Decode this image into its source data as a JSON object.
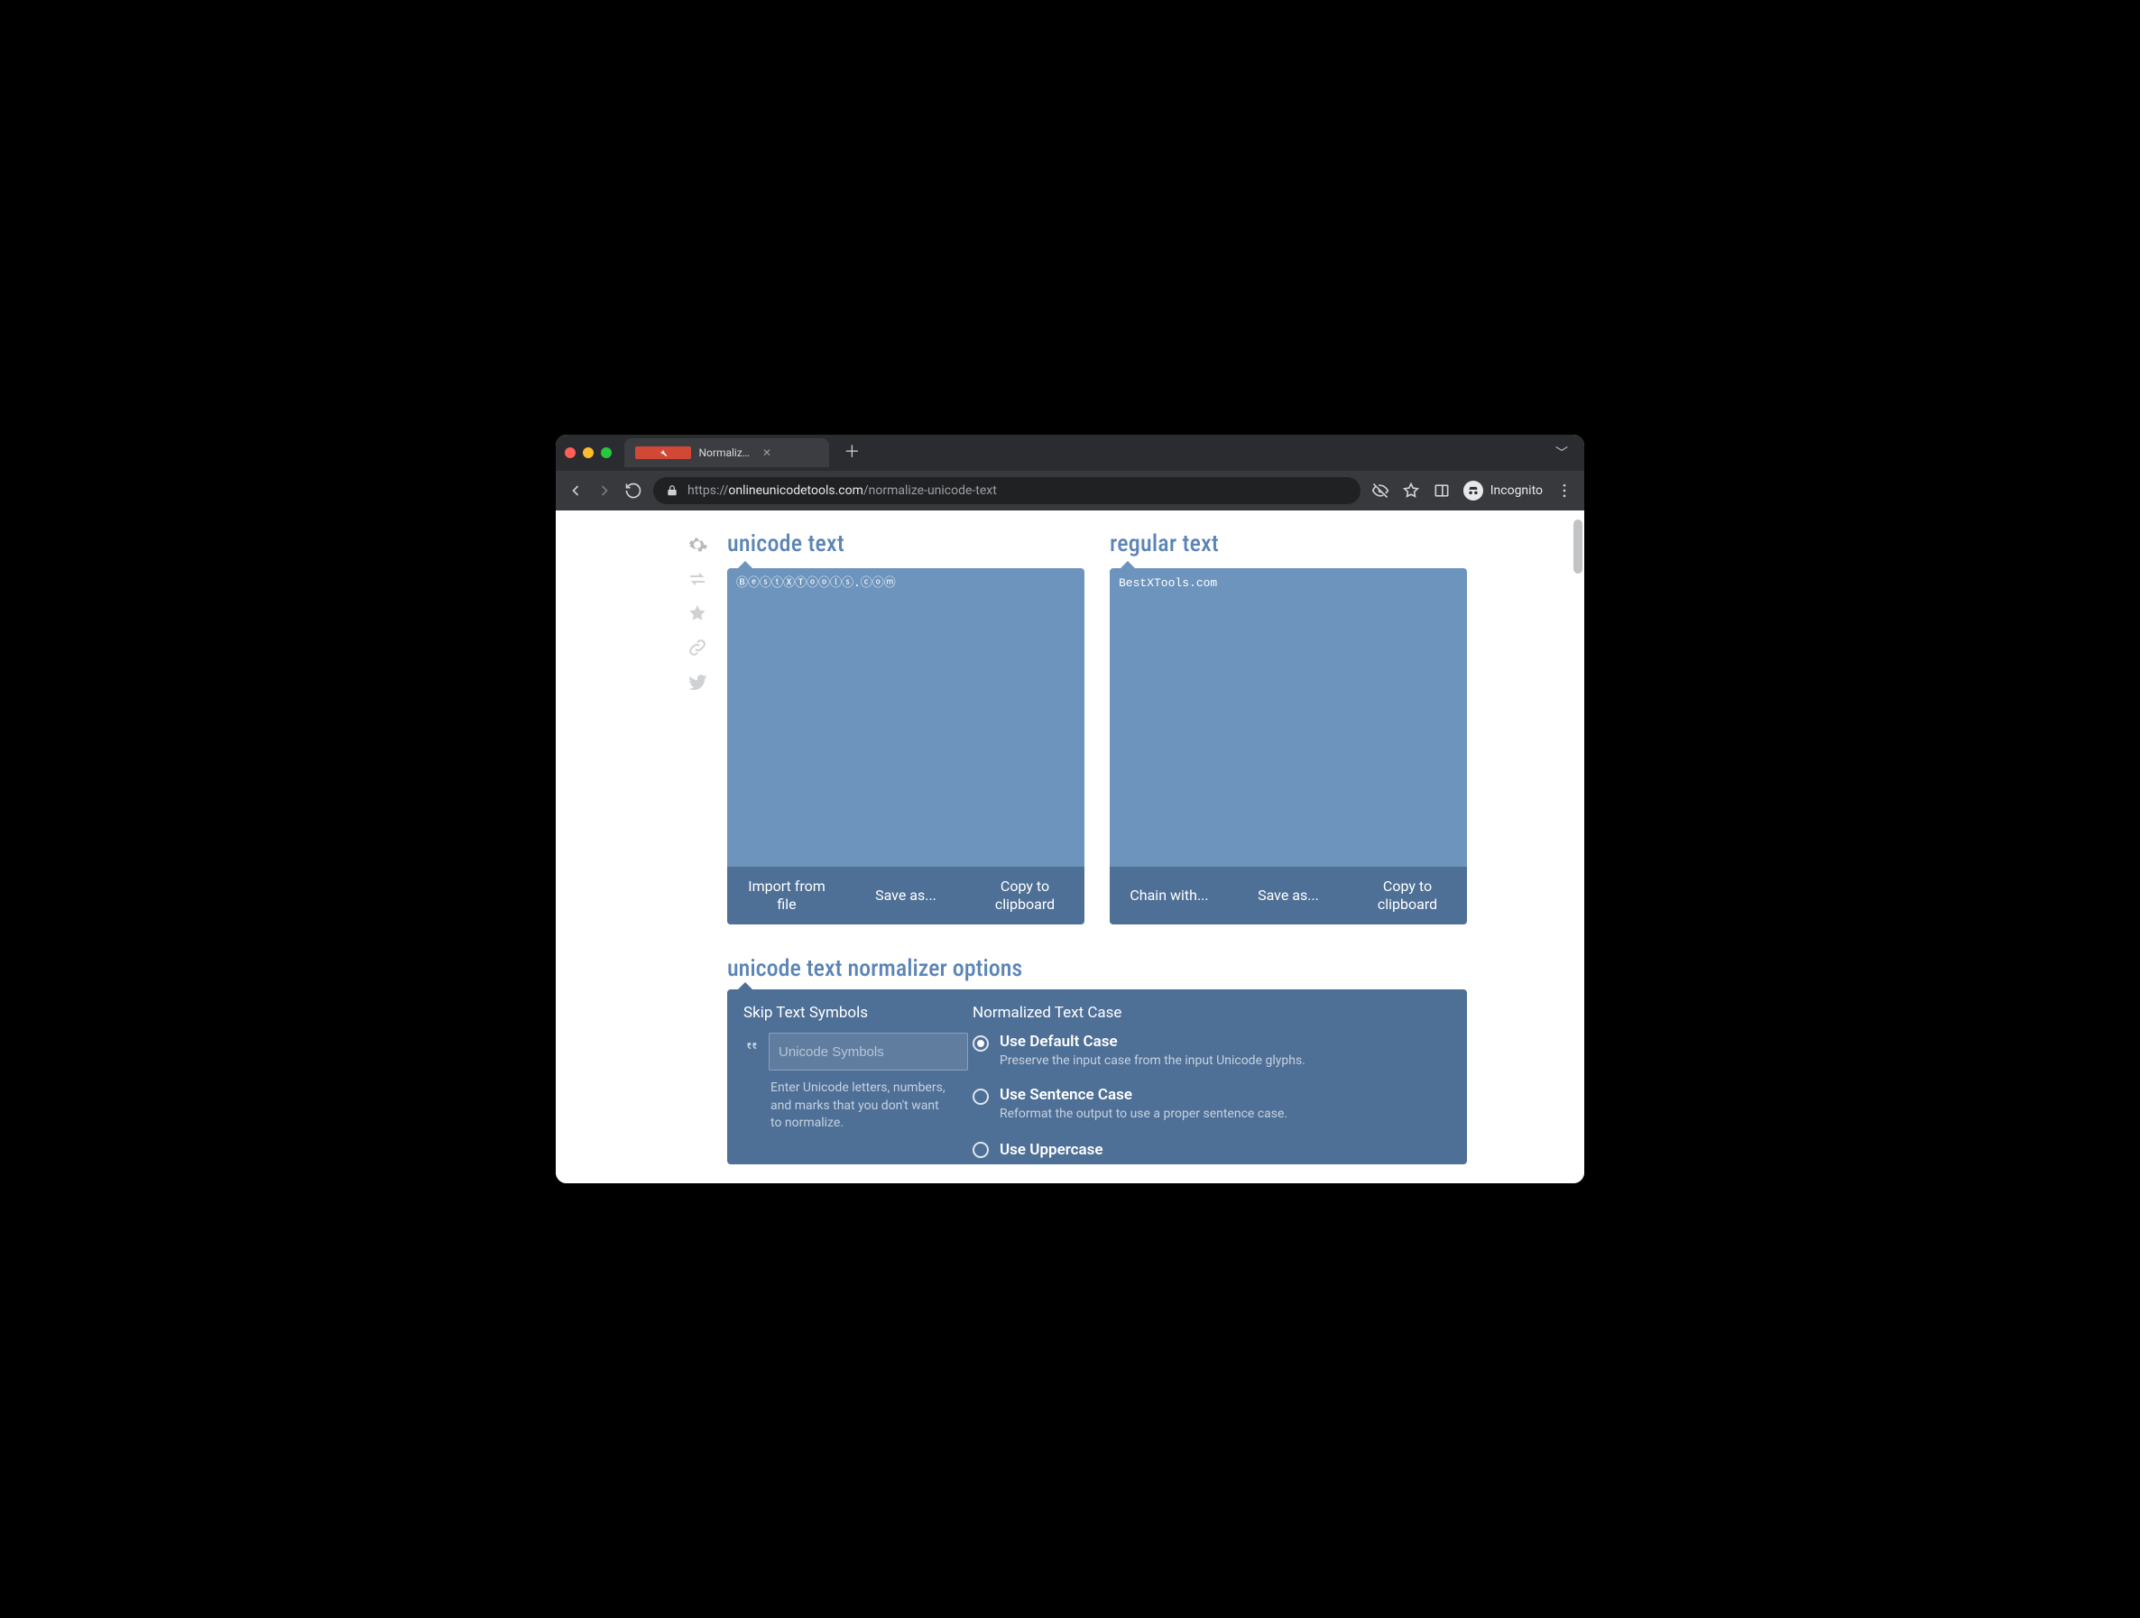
{
  "browser": {
    "tab_title": "Normalize Unicode Text - Onlin",
    "url_scheme": "https://",
    "url_host": "onlineunicodetools.com",
    "url_path": "/normalize-unicode-text",
    "incognito_label": "Incognito"
  },
  "input_panel": {
    "title": "unicode text",
    "value": "ⒷⓔⓢⓣⓍⓉⓞⓞⓛⓢ.ⓒⓞⓜ",
    "actions": {
      "import": "Import from file",
      "save": "Save as...",
      "copy": "Copy to clipboard"
    }
  },
  "output_panel": {
    "title": "regular text",
    "value": "BestXTools.com",
    "actions": {
      "chain": "Chain with...",
      "save": "Save as...",
      "copy": "Copy to clipboard"
    }
  },
  "options": {
    "heading": "unicode text normalizer options",
    "skip": {
      "heading": "Skip Text Symbols",
      "placeholder": "Unicode Symbols",
      "hint": "Enter Unicode letters, numbers, and marks that you don't want to normalize."
    },
    "case": {
      "heading": "Normalized Text Case",
      "items": [
        {
          "title": "Use Default Case",
          "desc": "Preserve the input case from the input Unicode glyphs.",
          "checked": true
        },
        {
          "title": "Use Sentence Case",
          "desc": "Reformat the output to use a proper sentence case.",
          "checked": false
        },
        {
          "title": "Use Uppercase",
          "desc": "",
          "checked": false
        }
      ]
    }
  }
}
